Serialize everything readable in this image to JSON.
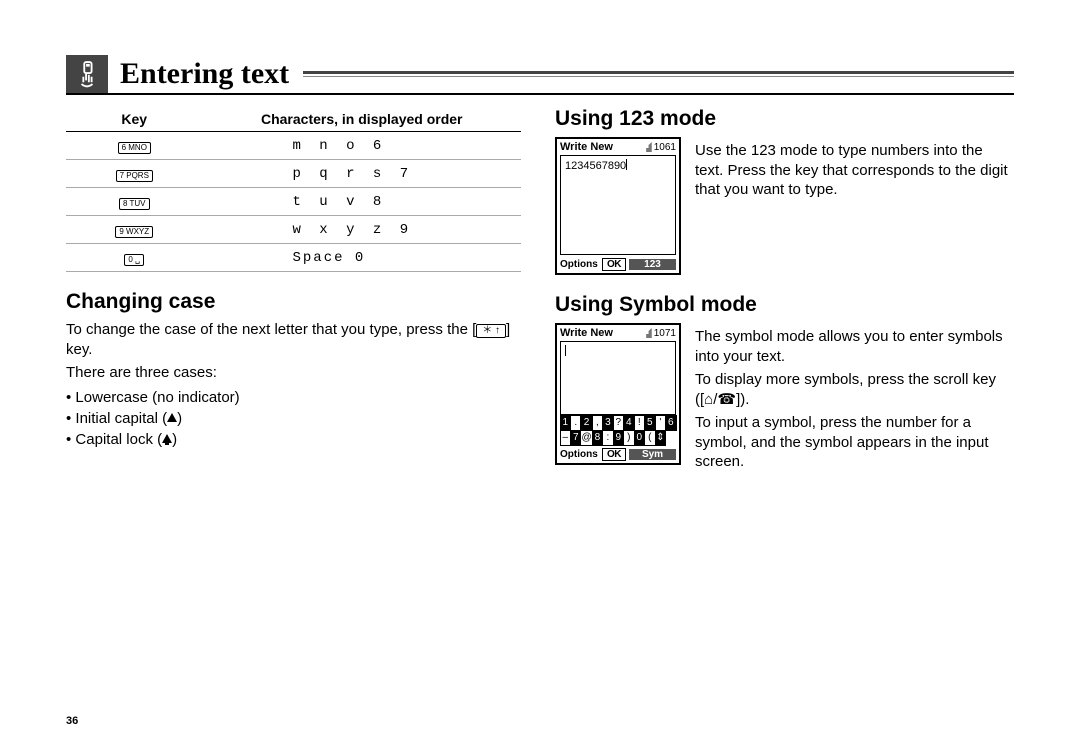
{
  "header": {
    "title": "Entering text"
  },
  "table": {
    "head_key": "Key",
    "head_chars": "Characters, in displayed order",
    "rows": [
      {
        "key": "6 MNO",
        "chars": "m n o 6"
      },
      {
        "key": "7 PQRS",
        "chars": "p q r s 7"
      },
      {
        "key": "8 TUV",
        "chars": "t u v 8"
      },
      {
        "key": "9 WXYZ",
        "chars": "w x y z 9"
      },
      {
        "key": "0 ␣",
        "chars": "Space 0"
      }
    ]
  },
  "changing_case": {
    "heading": "Changing case",
    "para1_a": "To change the case of the next letter that you type, press the [",
    "para1_key": "＊ ↑",
    "para1_b": "] key.",
    "para2": "There are three cases:",
    "cases": [
      "Lowercase (no indicator)",
      "Initial capital (",
      "Capital lock ("
    ],
    "close": ")"
  },
  "mode123": {
    "heading": "Using 123 mode",
    "screen": {
      "title": "Write New",
      "count": "1061",
      "content": "1234567890",
      "sk_left": "Options",
      "sk_mid": "OK",
      "sk_right": "123"
    },
    "text": "Use the 123 mode to type numbers into the text. Press the key that corresponds to the digit that you want to type."
  },
  "symbol": {
    "heading": "Using Symbol mode",
    "screen": {
      "title": "Write New",
      "count": "1071",
      "sk_left": "Options",
      "sk_mid": "OK",
      "sk_right": "Sym",
      "grid": [
        "1",
        ".",
        "2",
        ",",
        "3",
        "?",
        "4",
        "!",
        "5",
        "'",
        "6",
        "–",
        "7",
        "@",
        "8",
        ":",
        "9",
        ")",
        "0",
        "(",
        "⇕"
      ]
    },
    "para1": "The symbol mode allows you to enter symbols into your text.",
    "para2_a": "To display more symbols, press the scroll key ([",
    "para2_b": "]).",
    "para2_keys": "⌂/☎",
    "para3": "To input a symbol, press the number for a symbol, and the symbol appears in the input screen."
  },
  "page_number": "36"
}
